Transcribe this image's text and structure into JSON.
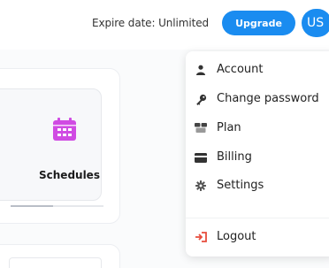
{
  "header": {
    "expire_text": "Expire date: Unlimited",
    "upgrade_label": "Upgrade",
    "avatar_initials": "US"
  },
  "dashboard": {
    "card_label": "Schedules",
    "card_icon": "calendar-icon",
    "card_icon_color": "#d04be3"
  },
  "user_menu": {
    "items": [
      {
        "label": "Account",
        "icon": "user-icon"
      },
      {
        "label": "Change password",
        "icon": "key-icon"
      },
      {
        "label": "Plan",
        "icon": "plan-icon"
      },
      {
        "label": "Billing",
        "icon": "credit-card-icon"
      },
      {
        "label": "Settings",
        "icon": "gear-icon"
      }
    ],
    "logout": {
      "label": "Logout",
      "icon": "logout-icon",
      "icon_color": "#e74c3c"
    }
  },
  "colors": {
    "accent": "#1a8cf0"
  }
}
